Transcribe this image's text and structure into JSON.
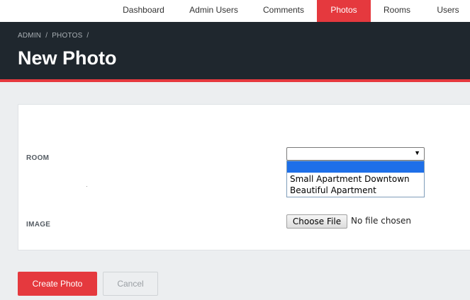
{
  "nav": {
    "items": [
      {
        "label": "Dashboard",
        "active": false
      },
      {
        "label": "Admin Users",
        "active": false
      },
      {
        "label": "Comments",
        "active": false
      },
      {
        "label": "Photos",
        "active": true
      },
      {
        "label": "Rooms",
        "active": false
      },
      {
        "label": "Users",
        "active": false
      }
    ]
  },
  "breadcrumb": {
    "items": [
      "ADMIN",
      "PHOTOS"
    ],
    "separator": "/"
  },
  "page": {
    "title": "New Photo"
  },
  "form": {
    "room": {
      "label": "ROOM",
      "selected_value": "",
      "options": [
        "",
        "Small Apartment Downtown",
        "Beautiful Apartment"
      ],
      "highlighted_option_index": 0
    },
    "image": {
      "label": "IMAGE",
      "button_label": "Choose File",
      "status_text": "No file chosen"
    }
  },
  "actions": {
    "create_label": "Create Photo",
    "cancel_label": "Cancel"
  },
  "colors": {
    "accent": "#e5393e",
    "header_bg": "#1f272e",
    "page_bg": "#eceef0",
    "dropdown_highlight": "#1e6fe8"
  },
  "icons": {
    "select_arrow": "dropdown-arrow-icon"
  }
}
